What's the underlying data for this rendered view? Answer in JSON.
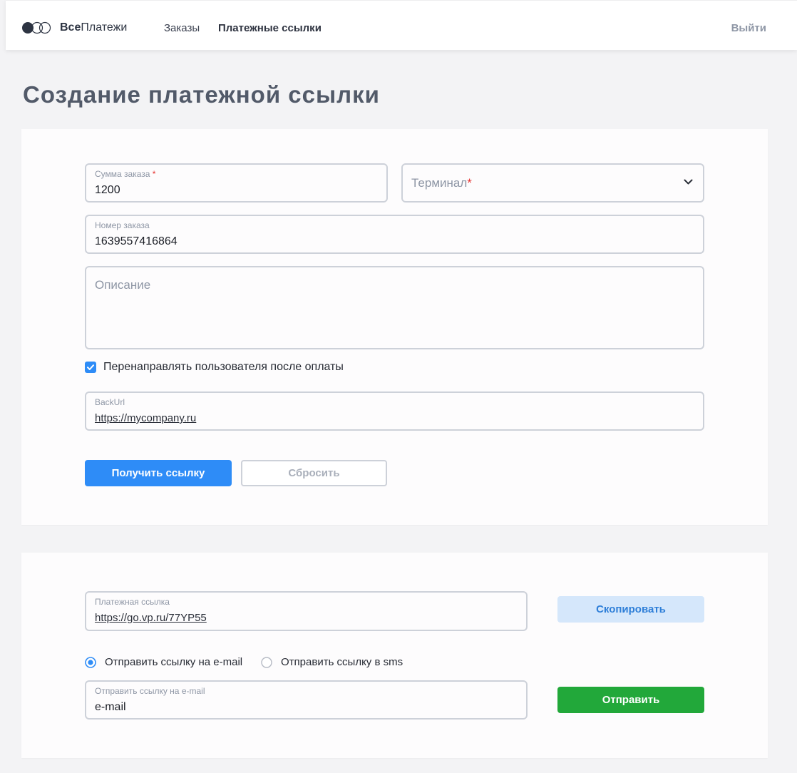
{
  "header": {
    "logo": {
      "bold": "Все",
      "rest": "Платежи"
    },
    "nav": [
      {
        "label": "Заказы",
        "active": false
      },
      {
        "label": "Платежные ссылки",
        "active": true
      }
    ],
    "logout": "Выйти"
  },
  "page": {
    "title": "Создание платежной ссылки"
  },
  "form": {
    "amount": {
      "label": "Сумма заказа",
      "required_mark": "*",
      "value": "1200"
    },
    "terminal": {
      "placeholder": "Терминал",
      "required_mark": "*"
    },
    "order_number": {
      "label": "Номер заказа",
      "value": "1639557416864"
    },
    "description": {
      "placeholder": "Описание"
    },
    "redirect": {
      "label": "Перенаправлять пользователя после оплаты",
      "checked": true
    },
    "back_url": {
      "label": "BackUrl",
      "value": "https://mycompany.ru"
    },
    "get_link_button": "Получить ссылку",
    "reset_button": "Сбросить"
  },
  "link_panel": {
    "payment_link": {
      "label": "Платежная ссылка",
      "value": "https://go.vp.ru/77YP55"
    },
    "copy_button": "Скопировать",
    "send_options": [
      {
        "label": "Отправить ссылку на e-mail",
        "selected": true
      },
      {
        "label": "Отправить ссылку в sms",
        "selected": false
      }
    ],
    "email": {
      "label": "Отправить ссылку на e-mail",
      "value": "e-mail"
    },
    "send_button": "Отправить"
  },
  "icons": [
    "logo-icon",
    "chevron-down-icon",
    "checkbox-checked-icon",
    "radio-checked-icon",
    "radio-unchecked-icon"
  ],
  "colors": {
    "accent": "#2e8cf7",
    "success": "#22a83a",
    "required": "#e5312f",
    "copy_button_bg": "#d5e7fb",
    "page_bg": "#f3f3f5"
  }
}
